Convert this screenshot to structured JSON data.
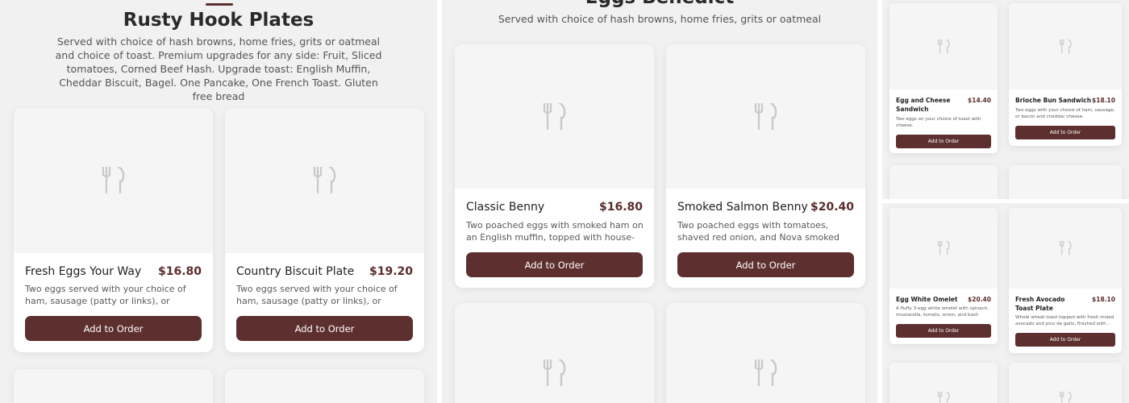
{
  "theme": {
    "accent": "#5e2f2f",
    "price": "#5b2c2c",
    "panel_bg": "#f1f1f1",
    "image_bg": "#f5f5f5"
  },
  "icon": "fork-knife-icon",
  "left": {
    "title": "Rusty Hook Plates",
    "description": "Served with choice of hash browns, home fries, grits or oatmeal and choice of toast. Premium upgrades for any side: Fruit, Sliced tomatoes, Corned Beef Hash. Upgrade toast: English Muffin, Cheddar Biscuit, Bagel. One Pancake, One French Toast. Gluten free bread",
    "items": [
      {
        "name": "Fresh Eggs Your Way",
        "price": "$16.80",
        "description": "Two eggs served with your choice of ham, sausage (patty or links), or bacon.",
        "button": "Add to Order"
      },
      {
        "name": "Country Biscuit Plate",
        "price": "$19.20",
        "description": "Two eggs served with your choice of ham, sausage (patty or links), or bacon, plus a...",
        "button": "Add to Order"
      }
    ]
  },
  "middle": {
    "title": "Eggs Benedict",
    "description": "Served with choice of hash browns, home fries, grits or oatmeal",
    "items": [
      {
        "name": "Classic Benny",
        "price": "$16.80",
        "description": "Two poached eggs with smoked ham on an English muffin, topped with house-made...",
        "button": "Add to Order"
      },
      {
        "name": "Smoked Salmon Benny",
        "price": "$20.40",
        "description": "Two poached eggs with tomatoes, shaved red onion, and Nova smoked salmon,...",
        "button": "Add to Order"
      }
    ]
  },
  "right_top": {
    "items": [
      {
        "name": "Egg and Cheese Sandwich",
        "price": "$14.40",
        "description": "Two eggs on your choice of toast with cheese.",
        "button": "Add to Order"
      },
      {
        "name": "Brioche Bun Sandwich",
        "price": "$18.10",
        "description": "Two eggs with your choice of ham, sausage, or bacon and cheddar cheese.",
        "button": "Add to Order"
      }
    ]
  },
  "right_bottom": {
    "items": [
      {
        "name": "Egg White Omelet",
        "price": "$20.40",
        "description": "A fluffy 3-egg white omelet with spinach, mozzarella, tomato, onion, and basil pesto.",
        "button": "Add to Order"
      },
      {
        "name": "Fresh Avocado Toast Plate",
        "price": "$18.10",
        "description": "Whole wheat toast topped with fresh mixed avocado and pico de gallo, finished with...",
        "button": "Add to Order"
      }
    ]
  }
}
